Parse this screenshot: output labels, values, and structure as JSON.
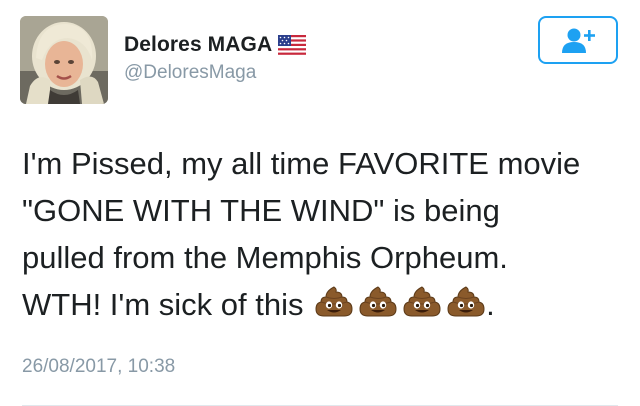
{
  "user": {
    "display_name": "Delores MAGA",
    "flag_icon": "us-flag-icon",
    "handle": "@DeloresMaga",
    "avatar_icon": "profile-photo"
  },
  "follow_button": {
    "icon": "add-user-icon",
    "color": "#1da1f2"
  },
  "tweet": {
    "lines": [
      "I'm Pissed, my all time FAVORITE movie",
      "\"GONE WITH THE WIND\" is being",
      "pulled from the Memphis Orpheum.",
      "WTH! I'm sick of this"
    ],
    "emoji_icon": "pile-of-poo-icon",
    "emoji_count": 4,
    "trailing_punct": ".",
    "timestamp": "26/08/2017, 10:38"
  },
  "colors": {
    "text": "#1c2022",
    "muted": "#8899a6",
    "accent": "#1da1f2"
  }
}
